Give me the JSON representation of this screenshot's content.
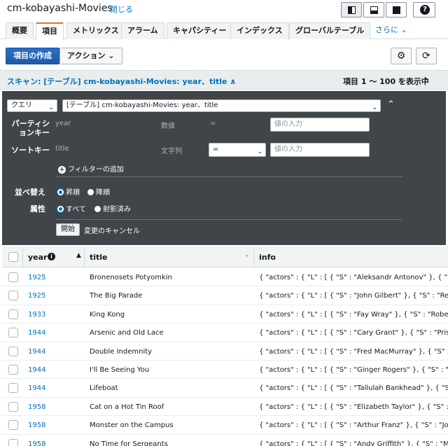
{
  "header": {
    "title": "cm-kobayashi-Movies",
    "close_label": "閉じる"
  },
  "tabs": [
    {
      "label": "概要"
    },
    {
      "label": "項目"
    },
    {
      "label": "メトリックス"
    },
    {
      "label": "アラーム"
    },
    {
      "label": "キャパシティー"
    },
    {
      "label": "インデックス"
    },
    {
      "label": "グローバルテーブル"
    },
    {
      "label": "さらに ⌄"
    }
  ],
  "actions": {
    "create_item": "項目の作成",
    "actions_menu": "アクション ⌄"
  },
  "scan": {
    "title": "スキャン: [テーブル] cm-kobayashi-Movies: year、title ∧",
    "range": "項目 1 ～ 100 を表示中"
  },
  "query": {
    "mode": "クエリ",
    "table_select": "[テーブル] cm-kobayashi-Movies: year、title",
    "partition_key_label": "パーティションキー",
    "partition_key_name": "year",
    "partition_key_type": "数値",
    "partition_key_op": "=",
    "partition_value_placeholder": "値の入力",
    "sort_key_label": "ソートキー",
    "sort_key_name": "title",
    "sort_key_type": "文字列",
    "sort_key_op": "=",
    "sort_value_placeholder": "値の入力",
    "add_filter": "フィルターの追加",
    "sort_label": "並べ替え",
    "sort_asc": "昇順",
    "sort_desc": "降順",
    "attr_label": "属性",
    "attr_all": "すべて",
    "attr_projected": "射影済み",
    "start_button": "開始",
    "cancel_changes": "変更のキャンセル"
  },
  "table": {
    "columns": [
      "year",
      "title",
      "info"
    ],
    "rows": [
      {
        "year": "1925",
        "title": "Bronenosets Potyomkin",
        "info": "{ \"actors\" : { \"L\" : [ { \"S\" : \"Aleksandr Antonov\" }, { \"S\" : \""
      },
      {
        "year": "1925",
        "title": "The Big Parade",
        "info": "{ \"actors\" : { \"L\" : [ { \"S\" : \"John Gilbert\" }, { \"S\" : \"Renee"
      },
      {
        "year": "1933",
        "title": "King Kong",
        "info": "{ \"actors\" : { \"L\" : [ { \"S\" : \"Fay Wray\" }, { \"S\" : \"Robert A"
      },
      {
        "year": "1944",
        "title": "Arsenic and Old Lace",
        "info": "{ \"actors\" : { \"L\" : [ { \"S\" : \"Cary Grant\" }, { \"S\" : \"Priscilla"
      },
      {
        "year": "1944",
        "title": "Double Indemnity",
        "info": "{ \"actors\" : { \"L\" : [ { \"S\" : \"Fred MacMurray\" }, { \"S\" : \"Ba"
      },
      {
        "year": "1944",
        "title": "I'll Be Seeing You",
        "info": "{ \"actors\" : { \"L\" : [ { \"S\" : \"Ginger Rogers\" }, { \"S\" : \"Jose"
      },
      {
        "year": "1944",
        "title": "Lifeboat",
        "info": "{ \"actors\" : { \"L\" : [ { \"S\" : \"Tallulah Bankhead\" }, { \"S\" : \"."
      },
      {
        "year": "1958",
        "title": "Cat on a Hot Tin Roof",
        "info": "{ \"actors\" : { \"L\" : [ { \"S\" : \"Elizabeth Taylor\" }, { \"S\" : \"Pa"
      },
      {
        "year": "1958",
        "title": "Monster on the Campus",
        "info": "{ \"actors\" : { \"L\" : [ { \"S\" : \"Arthur Franz\" }, { \"S\" : \"Joann"
      },
      {
        "year": "1958",
        "title": "No Time for Sergeants",
        "info": "{ \"actors\" : { \"L\" : [ { \"S\" : \"Andy Griffith\" }, { \"S\" : \"Myror"
      }
    ]
  },
  "colors": {
    "accent": "#ec7211",
    "link": "#0073bb",
    "primary_button": "#1f58a8",
    "query_panel": "#3f4549"
  },
  "icons": [
    "layout-split-icon",
    "layout-bottom-icon",
    "layout-full-icon",
    "help-icon",
    "settings-gear-icon",
    "refresh-icon",
    "chevron-right-icon"
  ]
}
